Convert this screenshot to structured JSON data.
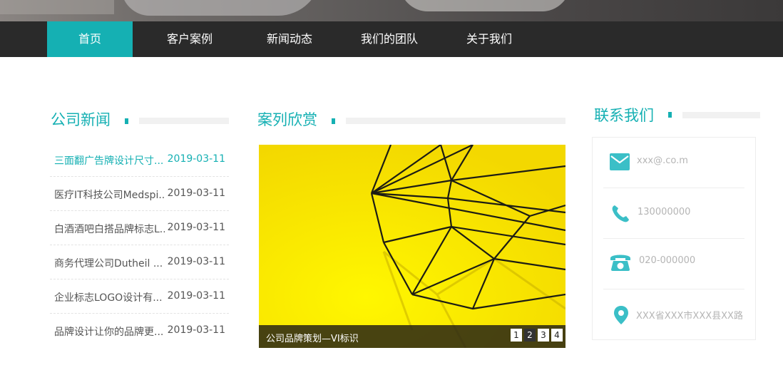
{
  "nav": {
    "items": [
      {
        "label": "首页"
      },
      {
        "label": "客户案例"
      },
      {
        "label": "新闻动态"
      },
      {
        "label": "我们的团队"
      },
      {
        "label": "关于我们"
      }
    ],
    "active_index": 0
  },
  "news": {
    "title": "公司新闻",
    "items": [
      {
        "title": "三面翻广告牌设计尺寸...",
        "date": "2019-03-11"
      },
      {
        "title": "医疗IT科技公司Medspi...",
        "date": "2019-03-11"
      },
      {
        "title": "白酒酒吧白搭品牌标志L...",
        "date": "2019-03-11"
      },
      {
        "title": "商务代理公司Dutheil ...",
        "date": "2019-03-11"
      },
      {
        "title": "企业标志LOGO设计有...",
        "date": "2019-03-11"
      },
      {
        "title": "品牌设计让你的品牌更...",
        "date": "2019-03-11"
      }
    ]
  },
  "cases": {
    "title": "案列欣赏",
    "caption": "公司品牌策划—VI标识",
    "pages": [
      "1",
      "2",
      "3",
      "4"
    ],
    "active_page": 1
  },
  "contact": {
    "title": "联系我们",
    "email": "xxx@.co.m",
    "phone": "130000000",
    "tel": "020-000000",
    "address": "XXX省XXX市XXX县XX路",
    "icons": [
      "mail-icon",
      "phone-icon",
      "telephone-icon",
      "location-pin-icon"
    ]
  },
  "colors": {
    "accent": "#15b0b3",
    "nav_bg": "#2a2a2a",
    "case_bg": "#ffe800"
  }
}
